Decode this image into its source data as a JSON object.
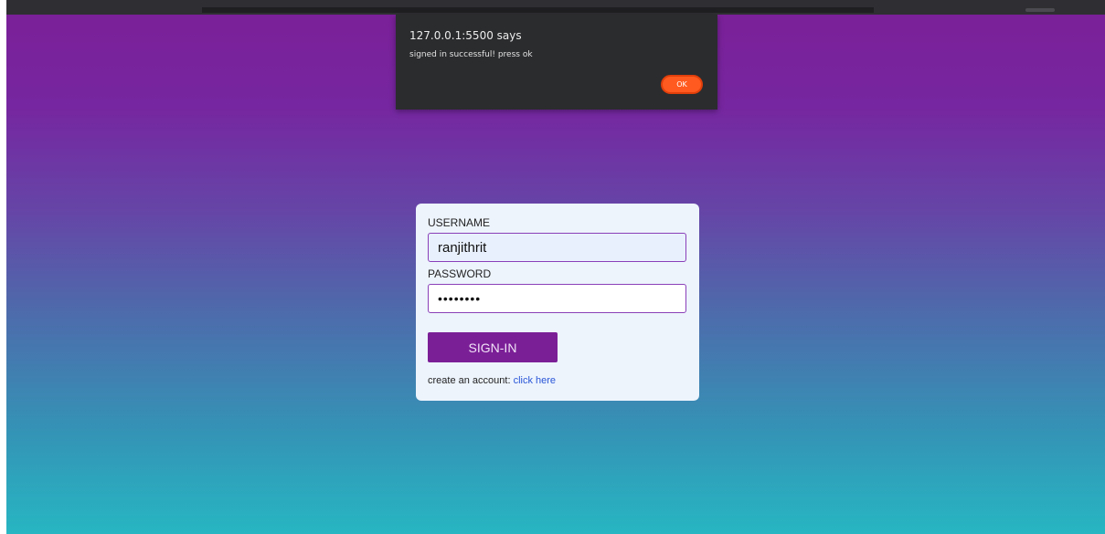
{
  "alert": {
    "title": "127.0.0.1:5500 says",
    "message": "signed in successful! press ok",
    "ok_label": "OK"
  },
  "form": {
    "username_label": "USERNAME",
    "username_value": "ranjithrit",
    "password_label": "PASSWORD",
    "password_value": "••••••••",
    "signin_label": "SIGN-IN",
    "create_text": "create an account: ",
    "create_link": "click here"
  },
  "colors": {
    "gradient_top": "#7b1f97",
    "gradient_bottom": "#27b6c2",
    "button": "#7b1f97",
    "ok_button": "#ff5a1f",
    "link": "#2a56d8"
  }
}
